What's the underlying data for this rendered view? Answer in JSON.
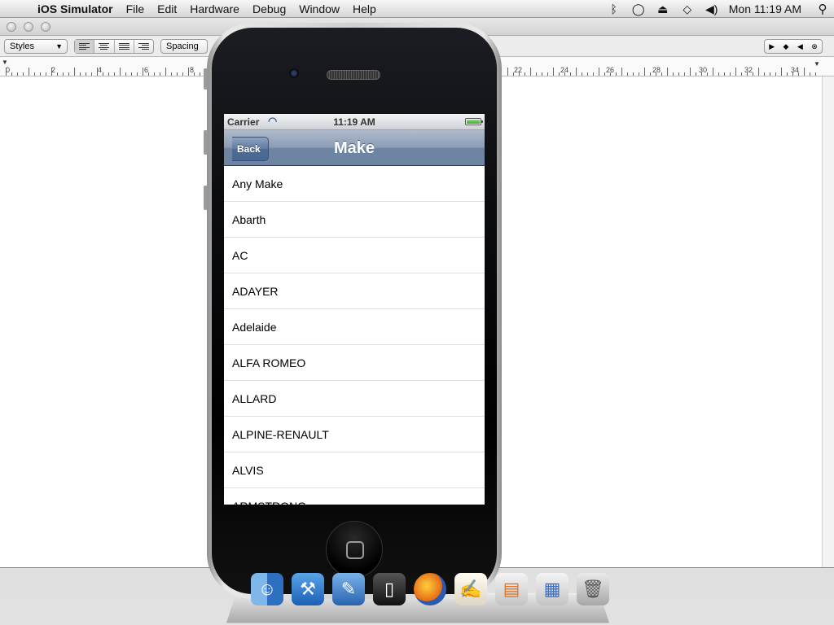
{
  "menubar": {
    "app_name": "iOS Simulator",
    "items": [
      "File",
      "Edit",
      "Hardware",
      "Debug",
      "Window",
      "Help"
    ],
    "clock": "Mon 11:19 AM"
  },
  "background_window": {
    "styles_label": "Styles",
    "spacing_label": "Spacing",
    "ruler_numbers": [
      "0",
      "2",
      "4",
      "6",
      "8",
      "22",
      "24",
      "26",
      "28",
      "30",
      "32",
      "34"
    ]
  },
  "ios": {
    "status": {
      "carrier": "Carrier",
      "time": "11:19 AM"
    },
    "nav": {
      "title": "Make",
      "back_label": "Back"
    },
    "makes": [
      "Any Make",
      "Abarth",
      "AC",
      "ADAYER",
      "Adelaide",
      "ALFA ROMEO",
      "ALLARD",
      "ALPINE-RENAULT",
      "ALVIS",
      "ARMSTRONG"
    ]
  },
  "dock": {
    "icons": [
      "finder-icon",
      "xcode-icon",
      "instruments-icon",
      "iphone-simulator-icon",
      "firefox-icon",
      "textedit-icon",
      "documents-stack-icon",
      "applications-stack-icon",
      "trash-icon"
    ]
  }
}
